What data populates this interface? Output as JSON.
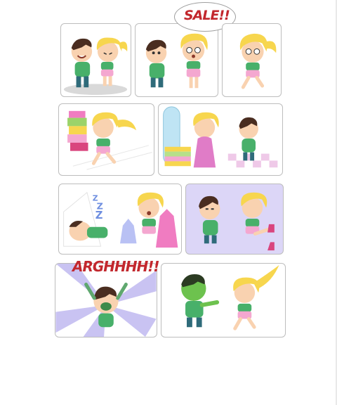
{
  "comic": {
    "sfx_sale": "SALE!!",
    "sfx_argh": "ARGHHHH!!"
  },
  "colors": {
    "skin": "#f9d2b0",
    "hair_blonde": "#f7d64e",
    "hair_brown": "#4a2d20",
    "shirt_green": "#48b06a",
    "dress_pink": "#f07cc1",
    "shorts_pink": "#f4a7d0",
    "panel_lavender": "#dcd6f7",
    "zombie_green": "#6dc24e",
    "sfx_red": "#c2272d"
  }
}
